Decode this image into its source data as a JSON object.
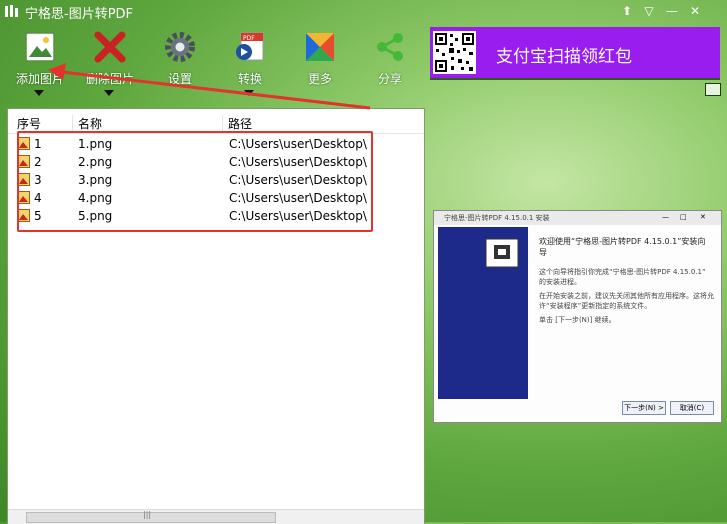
{
  "window": {
    "title": "宁格思-图片转PDF",
    "controls": {
      "skin": "⬆",
      "menu": "▽",
      "minimize": "—",
      "close": "✕"
    }
  },
  "toolbar": {
    "buttons": [
      {
        "label": "添加图片",
        "icon": "add-image-icon",
        "has_dropdown": true
      },
      {
        "label": "删除图片",
        "icon": "delete-x-icon",
        "has_dropdown": true
      },
      {
        "label": "设置",
        "icon": "gear-icon",
        "has_dropdown": false
      },
      {
        "label": "转换",
        "icon": "pdf-convert-icon",
        "has_dropdown": true
      },
      {
        "label": "更多",
        "icon": "more-apps-icon",
        "has_dropdown": false
      },
      {
        "label": "分享",
        "icon": "share-icon",
        "has_dropdown": false
      }
    ]
  },
  "ad": {
    "text": "支付宝扫描领红包",
    "bg": "#9a1df0"
  },
  "list": {
    "columns": [
      "序号",
      "名称",
      "路径"
    ],
    "rows": [
      {
        "index": "1",
        "name": "1.png",
        "path": "C:\\Users\\user\\Desktop\\"
      },
      {
        "index": "2",
        "name": "2.png",
        "path": "C:\\Users\\user\\Desktop\\"
      },
      {
        "index": "3",
        "name": "3.png",
        "path": "C:\\Users\\user\\Desktop\\"
      },
      {
        "index": "4",
        "name": "4.png",
        "path": "C:\\Users\\user\\Desktop\\"
      },
      {
        "index": "5",
        "name": "5.png",
        "path": "C:\\Users\\user\\Desktop\\"
      }
    ],
    "scroll_grip": "|||"
  },
  "preview": {
    "title": "宁格思-图片转PDF 4.15.0.1 安装",
    "heading": "欢迎使用“宁格思-图片转PDF 4.15.0.1”安装向导",
    "lines": [
      "这个向导将指引你完成“宁格思-图片转PDF 4.15.0.1”",
      "的安装进程。",
      "在开始安装之前，建议先关闭其他所有应用程序。这将允",
      "许“安装程序”更新指定的系统文件。",
      "单击 [下一步(N)] 继续。"
    ],
    "next_button": "下一步(N) >",
    "cancel_button": "取消(C)"
  },
  "colors": {
    "accent_red": "#e2332d",
    "ad_purple": "#9a1df0"
  }
}
